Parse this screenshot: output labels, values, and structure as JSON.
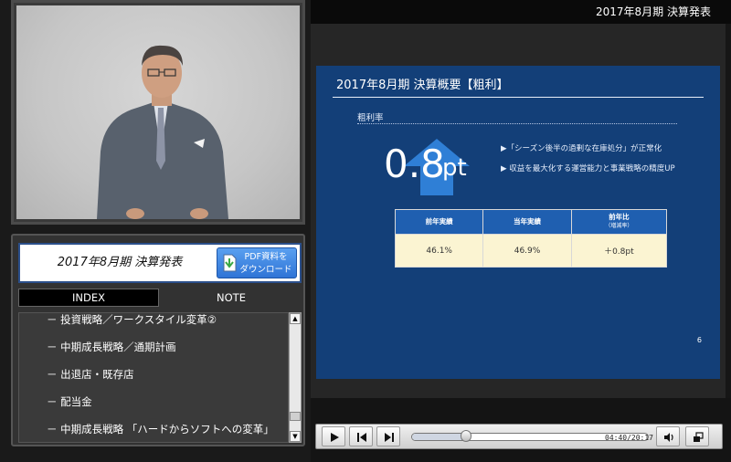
{
  "window": {
    "title": "2017年8月期 決算発表"
  },
  "left_panel": {
    "title_bar": {
      "title": "2017年8月期  決算発表",
      "pdf_button": {
        "line1": "PDF資料を",
        "line2": "ダウンロード",
        "icon": "pdf-download-icon"
      }
    },
    "tabs": {
      "index": "INDEX",
      "note": "NOTE"
    },
    "index_items": [
      "－ 投資戦略／ワークスタイル変革②",
      "－ 中期成長戦略／通期計画",
      "－ 出退店・既存店",
      "－ 配当金",
      "－ 中期成長戦略 「ハードからソフトへの変革」"
    ]
  },
  "slide": {
    "title": "2017年8月期 決算概要【粗利】",
    "section_label": "粗利率",
    "metric": {
      "value": "0.8",
      "unit": "pt",
      "direction": "up",
      "arrow_color": "#2f7fd6"
    },
    "bullets": [
      "▶「シーズン後半の過剰な在庫処分」が正常化",
      "▶ 収益を最大化する運営能力と事業戦略の精度UP"
    ],
    "table": {
      "headers": [
        "前年実績",
        "当年実績",
        "前年比"
      ],
      "header_note": "（増減率）",
      "row": [
        "46.1%",
        "46.9%",
        "＋0.8pt"
      ]
    },
    "page_number": "6",
    "colors": {
      "background": "#133f78",
      "table_header": "#1f5fb0",
      "table_body": "#fbf4d2"
    }
  },
  "player": {
    "time": "04:40/20:17",
    "progress_percent": 23,
    "buttons": [
      "play",
      "previous-chapter",
      "next-chapter",
      "volume",
      "fullscreen"
    ]
  }
}
